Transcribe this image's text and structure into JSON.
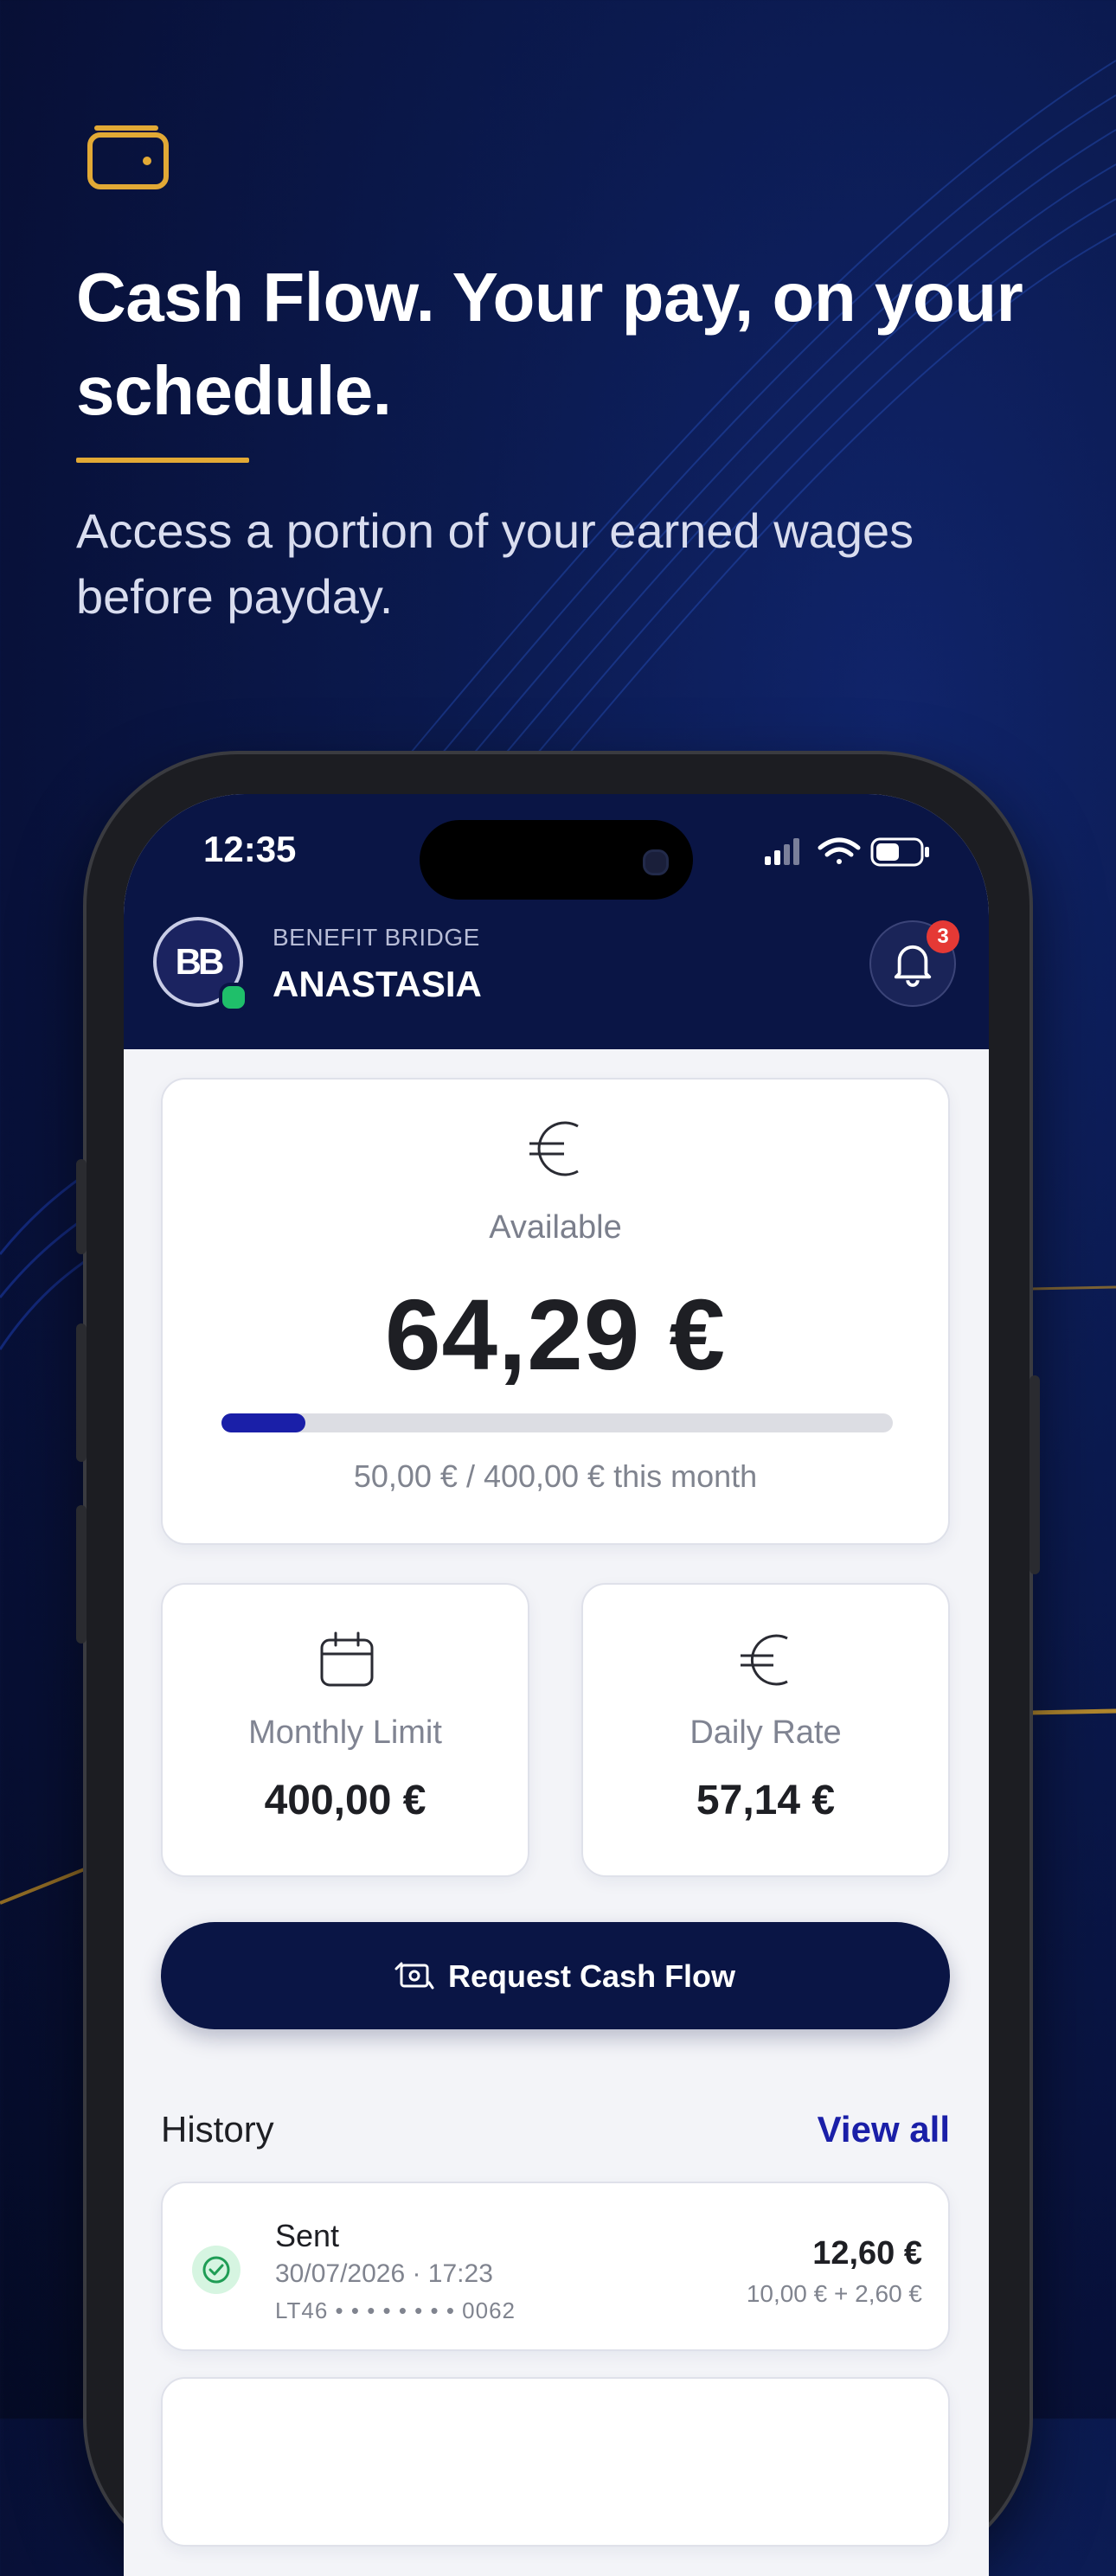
{
  "promo": {
    "headline": "Cash Flow. Your pay, on your schedule.",
    "subheadline": "Access a portion of your earned wages before payday."
  },
  "status_bar": {
    "time": "12:35"
  },
  "app_header": {
    "logo_text": "BB",
    "brand": "BENEFIT BRIDGE",
    "user_name": "ANASTASIA",
    "notification_count": "3"
  },
  "available": {
    "label": "Available",
    "amount": "64,29 €",
    "usage_text": "50,00 € / 400,00 € this month",
    "progress_fraction": 0.125
  },
  "stats": {
    "monthly_limit_label": "Monthly Limit",
    "monthly_limit_value": "400,00 €",
    "daily_rate_label": "Daily Rate",
    "daily_rate_value": "57,14 €"
  },
  "request_button_label": "Request Cash Flow",
  "history": {
    "title": "History",
    "view_all": "View all",
    "items": [
      {
        "status": "Sent",
        "datetime": "30/07/2026 · 17:23",
        "account": "LT46 • • • • • • • • 0062",
        "amount": "12,60 €",
        "breakdown": "10,00 € + 2,60 €"
      }
    ]
  },
  "colors": {
    "navy": "#0a1545",
    "accent_gold": "#e2a935",
    "progress_blue": "#1a1fa8",
    "success_green": "#1fbf6a",
    "badge_red": "#e53935"
  }
}
